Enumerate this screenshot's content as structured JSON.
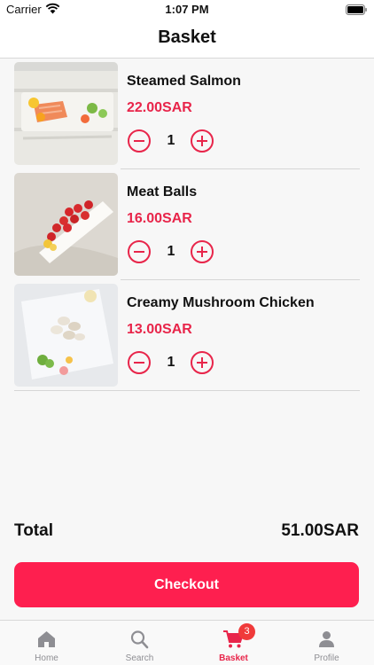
{
  "status_bar": {
    "carrier": "Carrier",
    "time": "1:07 PM"
  },
  "nav": {
    "title": "Basket"
  },
  "items": [
    {
      "name": "Steamed Salmon",
      "price": "22.00SAR",
      "quantity": "1"
    },
    {
      "name": "Meat Balls",
      "price": "16.00SAR",
      "quantity": "1"
    },
    {
      "name": "Creamy Mushroom Chicken",
      "price": "13.00SAR",
      "quantity": "1"
    }
  ],
  "total": {
    "label": "Total",
    "value": "51.00SAR"
  },
  "checkout": {
    "label": "Checkout"
  },
  "tabs": [
    {
      "label": "Home",
      "icon": "home-icon"
    },
    {
      "label": "Search",
      "icon": "search-icon"
    },
    {
      "label": "Basket",
      "icon": "cart-icon",
      "badge": "3",
      "active": true
    },
    {
      "label": "Profile",
      "icon": "person-icon"
    }
  ],
  "colors": {
    "accent": "#fe1f4f",
    "price": "#e8254a",
    "badge": "#f03a3a"
  }
}
